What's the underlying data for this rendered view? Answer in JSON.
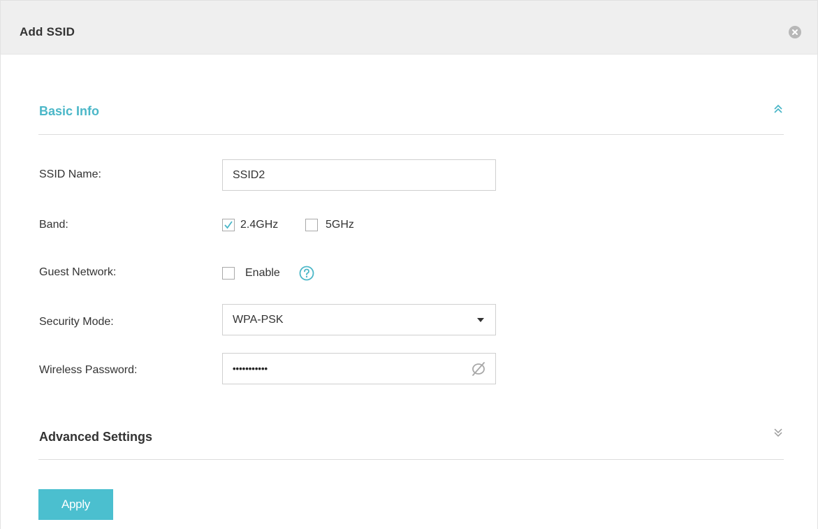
{
  "dialog": {
    "title": "Add SSID",
    "close_icon": "close-circle-icon"
  },
  "basic_info": {
    "title": "Basic Info",
    "toggle_icon": "double-chevron-up-icon",
    "accent_color": "#4bb7c8"
  },
  "fields": {
    "ssid_name": {
      "label": "SSID Name:",
      "value": "SSID2"
    },
    "band": {
      "label": "Band:",
      "options": [
        {
          "label": "2.4GHz",
          "checked": true
        },
        {
          "label": "5GHz",
          "checked": false
        }
      ]
    },
    "guest_network": {
      "label": "Guest Network:",
      "checkbox_label": "Enable",
      "checked": false,
      "help_icon": "question-circle-icon"
    },
    "security_mode": {
      "label": "Security Mode:",
      "value": "WPA-PSK"
    },
    "wireless_password": {
      "label": "Wireless Password:",
      "value_masked": "•••••••••••",
      "visibility_icon": "eye-slash-icon"
    }
  },
  "advanced": {
    "title": "Advanced Settings",
    "toggle_icon": "double-chevron-down-icon"
  },
  "actions": {
    "apply_label": "Apply",
    "apply_color": "#4bbfcf"
  }
}
